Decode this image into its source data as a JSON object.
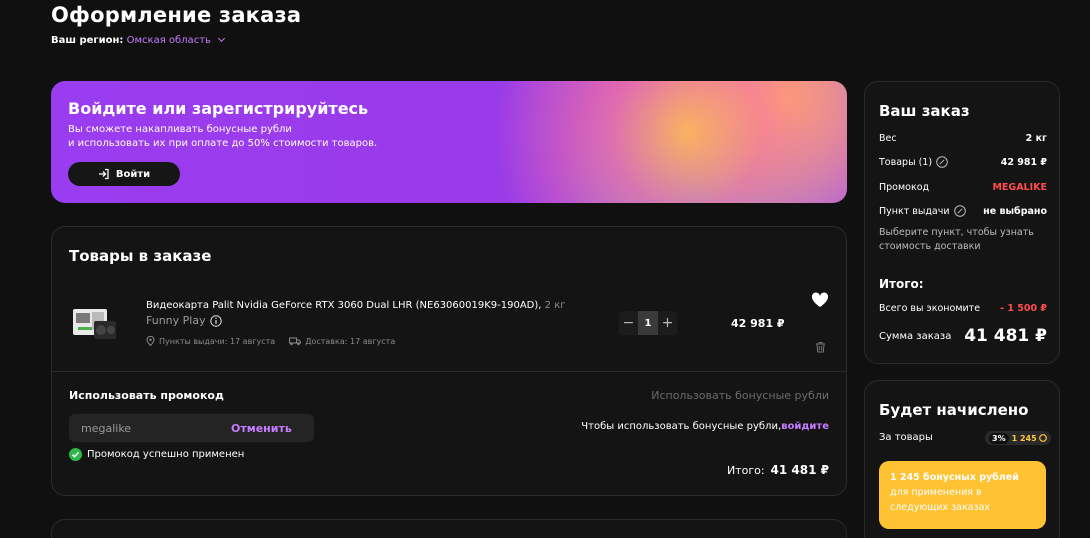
{
  "header": {
    "title": "Оформление заказа",
    "region_label": "Ваш регион:",
    "region_value": "Омская область"
  },
  "banner": {
    "title": "Войдите или зарегистрируйтесь",
    "line1": "Вы сможете накапливать бонусные рубли",
    "line2": "и использовать их при оплате до 50% стоимости товаров.",
    "login_label": "Войти"
  },
  "cart": {
    "title": "Товары в заказе",
    "product": {
      "name": "Видеокарта Palit Nvidia GeForce RTX 3060 Dual LHR (NE63060019K9-190AD),",
      "weight": " 2 кг",
      "seller": "Funny Play",
      "pickup": "Пункты выдачи: 17 августа",
      "delivery": "Доставка: 17 августа",
      "quantity": "1",
      "price": "42 981 ₽"
    },
    "promo_title": "Использовать промокод",
    "promo_value": "megalike",
    "promo_cancel": "Отменить",
    "promo_success": "Промокод успешно применен",
    "bonus_link": "Использовать бонусные рубли",
    "bonus_note": "Чтобы использовать бонусные рубли,",
    "bonus_login": "войдите",
    "total_label": "Итого:",
    "total_value": "41 481 ₽"
  },
  "summary": {
    "title": "Ваш заказ",
    "weight_label": "Вес",
    "weight_value": "2 кг",
    "goods_label": "Товары (1)",
    "goods_value": "42 981 ₽",
    "promo_label": "Промокод",
    "promo_value": "MEGALIKE",
    "pickup_label": "Пункт выдачи",
    "pickup_value": "не выбрано",
    "hint": "Выберите пункт, чтобы узнать стоимость доставки",
    "itogo": "Итого:",
    "save_label": "Всего вы экономите",
    "save_value": "- 1 500 ₽",
    "sum_label": "Сумма заказа",
    "sum_value": "41 481 ₽"
  },
  "bonus": {
    "title": "Будет начислено",
    "for_goods": "За товары",
    "percent": "3%",
    "amount": "1 245",
    "box_title": "1 245 бонусных рублей",
    "box_text": "для применения в следующих заказах"
  },
  "colors": {
    "accent": "#c77dff",
    "promo_red": "#ff4d4d",
    "bonus_yellow": "#ffc233",
    "success_green": "#2fb84a"
  }
}
